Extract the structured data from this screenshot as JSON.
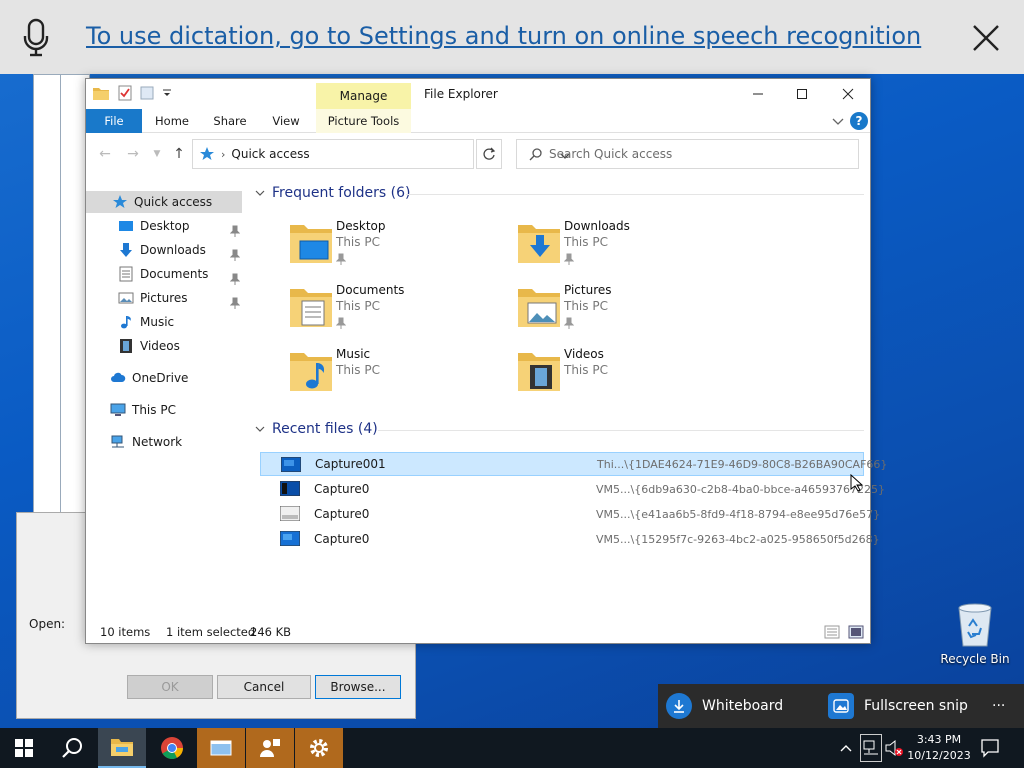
{
  "dictation": {
    "message": "To use dictation, go to Settings and turn on online speech recognition"
  },
  "run_dialog": {
    "open_label": "Open:",
    "ok_label": "OK",
    "cancel_label": "Cancel",
    "browse_label": "Browse..."
  },
  "explorer": {
    "title": "File Explorer",
    "manage_label": "Manage",
    "ribbon_tabs": {
      "file": "File",
      "home": "Home",
      "share": "Share",
      "view": "View",
      "picture_tools": "Picture Tools"
    },
    "address": "Quick access",
    "search_placeholder": "Search Quick access",
    "nav": {
      "quick_access": "Quick access",
      "desktop": "Desktop",
      "downloads": "Downloads",
      "documents": "Documents",
      "pictures": "Pictures",
      "music": "Music",
      "videos": "Videos",
      "onedrive": "OneDrive",
      "this_pc": "This PC",
      "network": "Network"
    },
    "frequent_header": "Frequent folders (6)",
    "folders": [
      {
        "name": "Desktop",
        "location": "This PC"
      },
      {
        "name": "Downloads",
        "location": "This PC"
      },
      {
        "name": "Documents",
        "location": "This PC"
      },
      {
        "name": "Pictures",
        "location": "This PC"
      },
      {
        "name": "Music",
        "location": "This PC"
      },
      {
        "name": "Videos",
        "location": "This PC"
      }
    ],
    "recent_header": "Recent files (4)",
    "recent_files": [
      {
        "name": "Capture001",
        "path": "Thi...\\{1DAE4624-71E9-46D9-80C8-B26BA90CAF66}"
      },
      {
        "name": "Capture0",
        "path": "VM5...\\{6db9a630-c2b8-4ba0-bbce-a46593767225}"
      },
      {
        "name": "Capture0",
        "path": "VM5...\\{e41aa6b5-8fd9-4f18-8794-e8ee95d76e57}"
      },
      {
        "name": "Capture0",
        "path": "VM5...\\{15295f7c-9263-4bc2-a025-958650f5d268}"
      }
    ],
    "status": {
      "items": "10 items",
      "selected": "1 item selected",
      "size": "246 KB"
    }
  },
  "desktop": {
    "recycle_bin": "Recycle Bin"
  },
  "snip_bar": {
    "whiteboard": "Whiteboard",
    "fullscreen": "Fullscreen snip",
    "more": "···"
  },
  "taskbar": {
    "time": "3:43 PM",
    "date": "10/12/2023"
  },
  "colors": {
    "accent": "#1979ca",
    "selection": "#cce8ff",
    "link": "#1a5ea6"
  }
}
